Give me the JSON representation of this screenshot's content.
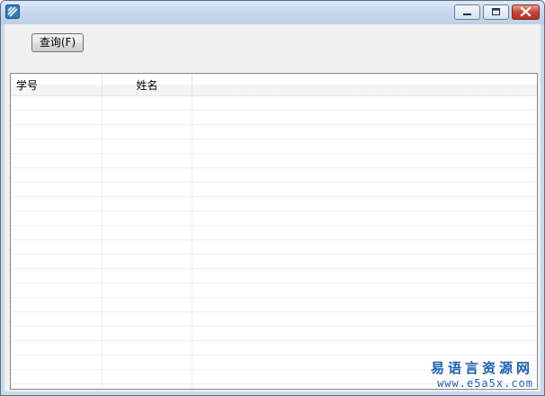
{
  "window": {
    "title": "",
    "controls": {
      "minimize": "minimize-icon",
      "maximize": "maximize-icon",
      "close": "close-icon"
    },
    "accent_color": "#c4d5ea"
  },
  "toolbar": {
    "query_label": "查询(F)"
  },
  "listview": {
    "columns": [
      "学号",
      "姓名",
      ""
    ],
    "rows": []
  },
  "watermark": {
    "name": "易语言资源网",
    "url": "www.e5a5x.com"
  }
}
